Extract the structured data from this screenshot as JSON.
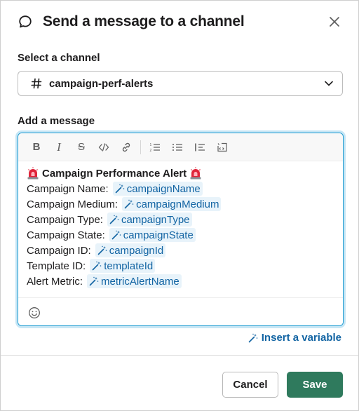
{
  "modal": {
    "title": "Send a message to a channel",
    "header_icon": "speech-bubble-icon",
    "close_icon": "close-icon"
  },
  "channel": {
    "label": "Select a channel",
    "value": "campaign-perf-alerts",
    "icon": "hash-icon"
  },
  "message": {
    "label": "Add a message",
    "toolbar": {
      "bold": "B",
      "italic": "I",
      "strike": "S"
    },
    "heading": "Campaign Performance Alert",
    "lines": [
      {
        "label": "Campaign Name:",
        "variable": "campaignName"
      },
      {
        "label": "Campaign Medium:",
        "variable": "campaignMedium"
      },
      {
        "label": "Campaign Type:",
        "variable": "campaignType"
      },
      {
        "label": "Campaign State:",
        "variable": "campaignState"
      },
      {
        "label": "Campaign ID:",
        "variable": "campaignId"
      },
      {
        "label": "Template ID:",
        "variable": "templateId"
      },
      {
        "label": "Alert Metric:",
        "variable": "metricAlertName"
      }
    ]
  },
  "insert_variable": "Insert a variable",
  "buttons": {
    "cancel": "Cancel",
    "save": "Save"
  },
  "colors": {
    "accent_blue": "#1264a3",
    "variable_bg": "#e8f3fa",
    "save_green": "#2f7a5d",
    "focus_border": "#1d9bd1"
  }
}
